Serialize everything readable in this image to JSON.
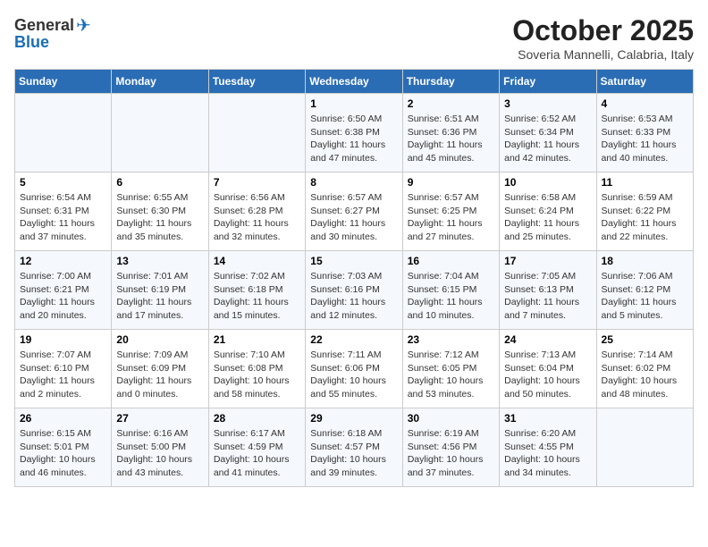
{
  "header": {
    "logo_general": "General",
    "logo_blue": "Blue",
    "month": "October 2025",
    "location": "Soveria Mannelli, Calabria, Italy"
  },
  "days_of_week": [
    "Sunday",
    "Monday",
    "Tuesday",
    "Wednesday",
    "Thursday",
    "Friday",
    "Saturday"
  ],
  "weeks": [
    [
      {
        "day": "",
        "info": ""
      },
      {
        "day": "",
        "info": ""
      },
      {
        "day": "",
        "info": ""
      },
      {
        "day": "1",
        "info": "Sunrise: 6:50 AM\nSunset: 6:38 PM\nDaylight: 11 hours\nand 47 minutes."
      },
      {
        "day": "2",
        "info": "Sunrise: 6:51 AM\nSunset: 6:36 PM\nDaylight: 11 hours\nand 45 minutes."
      },
      {
        "day": "3",
        "info": "Sunrise: 6:52 AM\nSunset: 6:34 PM\nDaylight: 11 hours\nand 42 minutes."
      },
      {
        "day": "4",
        "info": "Sunrise: 6:53 AM\nSunset: 6:33 PM\nDaylight: 11 hours\nand 40 minutes."
      }
    ],
    [
      {
        "day": "5",
        "info": "Sunrise: 6:54 AM\nSunset: 6:31 PM\nDaylight: 11 hours\nand 37 minutes."
      },
      {
        "day": "6",
        "info": "Sunrise: 6:55 AM\nSunset: 6:30 PM\nDaylight: 11 hours\nand 35 minutes."
      },
      {
        "day": "7",
        "info": "Sunrise: 6:56 AM\nSunset: 6:28 PM\nDaylight: 11 hours\nand 32 minutes."
      },
      {
        "day": "8",
        "info": "Sunrise: 6:57 AM\nSunset: 6:27 PM\nDaylight: 11 hours\nand 30 minutes."
      },
      {
        "day": "9",
        "info": "Sunrise: 6:57 AM\nSunset: 6:25 PM\nDaylight: 11 hours\nand 27 minutes."
      },
      {
        "day": "10",
        "info": "Sunrise: 6:58 AM\nSunset: 6:24 PM\nDaylight: 11 hours\nand 25 minutes."
      },
      {
        "day": "11",
        "info": "Sunrise: 6:59 AM\nSunset: 6:22 PM\nDaylight: 11 hours\nand 22 minutes."
      }
    ],
    [
      {
        "day": "12",
        "info": "Sunrise: 7:00 AM\nSunset: 6:21 PM\nDaylight: 11 hours\nand 20 minutes."
      },
      {
        "day": "13",
        "info": "Sunrise: 7:01 AM\nSunset: 6:19 PM\nDaylight: 11 hours\nand 17 minutes."
      },
      {
        "day": "14",
        "info": "Sunrise: 7:02 AM\nSunset: 6:18 PM\nDaylight: 11 hours\nand 15 minutes."
      },
      {
        "day": "15",
        "info": "Sunrise: 7:03 AM\nSunset: 6:16 PM\nDaylight: 11 hours\nand 12 minutes."
      },
      {
        "day": "16",
        "info": "Sunrise: 7:04 AM\nSunset: 6:15 PM\nDaylight: 11 hours\nand 10 minutes."
      },
      {
        "day": "17",
        "info": "Sunrise: 7:05 AM\nSunset: 6:13 PM\nDaylight: 11 hours\nand 7 minutes."
      },
      {
        "day": "18",
        "info": "Sunrise: 7:06 AM\nSunset: 6:12 PM\nDaylight: 11 hours\nand 5 minutes."
      }
    ],
    [
      {
        "day": "19",
        "info": "Sunrise: 7:07 AM\nSunset: 6:10 PM\nDaylight: 11 hours\nand 2 minutes."
      },
      {
        "day": "20",
        "info": "Sunrise: 7:09 AM\nSunset: 6:09 PM\nDaylight: 11 hours\nand 0 minutes."
      },
      {
        "day": "21",
        "info": "Sunrise: 7:10 AM\nSunset: 6:08 PM\nDaylight: 10 hours\nand 58 minutes."
      },
      {
        "day": "22",
        "info": "Sunrise: 7:11 AM\nSunset: 6:06 PM\nDaylight: 10 hours\nand 55 minutes."
      },
      {
        "day": "23",
        "info": "Sunrise: 7:12 AM\nSunset: 6:05 PM\nDaylight: 10 hours\nand 53 minutes."
      },
      {
        "day": "24",
        "info": "Sunrise: 7:13 AM\nSunset: 6:04 PM\nDaylight: 10 hours\nand 50 minutes."
      },
      {
        "day": "25",
        "info": "Sunrise: 7:14 AM\nSunset: 6:02 PM\nDaylight: 10 hours\nand 48 minutes."
      }
    ],
    [
      {
        "day": "26",
        "info": "Sunrise: 6:15 AM\nSunset: 5:01 PM\nDaylight: 10 hours\nand 46 minutes."
      },
      {
        "day": "27",
        "info": "Sunrise: 6:16 AM\nSunset: 5:00 PM\nDaylight: 10 hours\nand 43 minutes."
      },
      {
        "day": "28",
        "info": "Sunrise: 6:17 AM\nSunset: 4:59 PM\nDaylight: 10 hours\nand 41 minutes."
      },
      {
        "day": "29",
        "info": "Sunrise: 6:18 AM\nSunset: 4:57 PM\nDaylight: 10 hours\nand 39 minutes."
      },
      {
        "day": "30",
        "info": "Sunrise: 6:19 AM\nSunset: 4:56 PM\nDaylight: 10 hours\nand 37 minutes."
      },
      {
        "day": "31",
        "info": "Sunrise: 6:20 AM\nSunset: 4:55 PM\nDaylight: 10 hours\nand 34 minutes."
      },
      {
        "day": "",
        "info": ""
      }
    ]
  ]
}
